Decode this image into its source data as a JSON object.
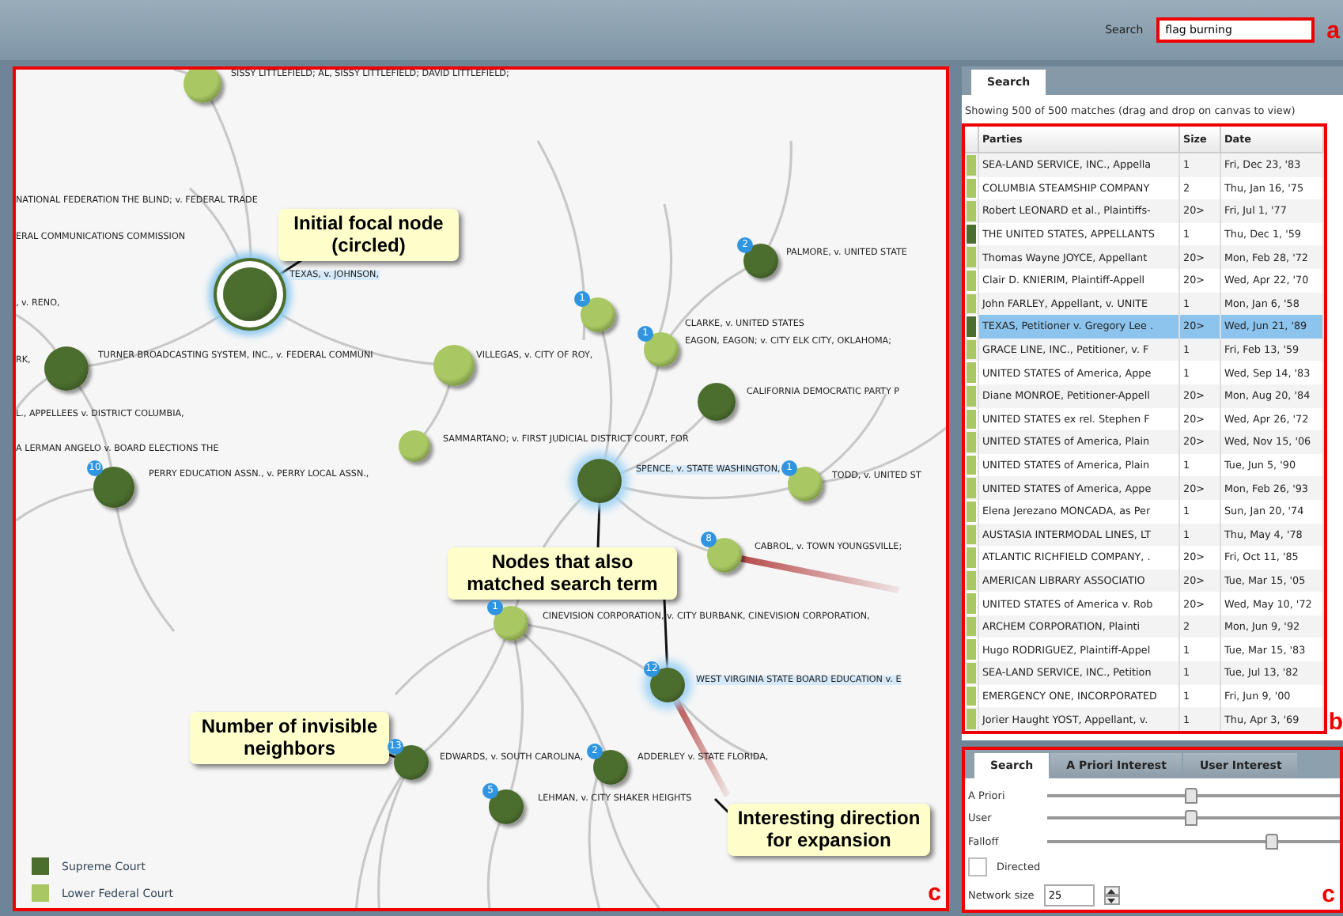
{
  "toolbar": {
    "search_label": "Search",
    "search_value": "flag burning",
    "annotation": "a"
  },
  "canvas": {
    "annotation": "c",
    "fragments": [
      "NATIONAL FEDERATION THE BLIND; v. FEDERAL TRADE",
      "ERAL COMMUNICATIONS COMMISSION",
      ", v. RENO,",
      "RK,",
      "L., APPELLEES v. DISTRICT COLUMBIA,",
      "A LERMAN ANGELO v. BOARD ELECTIONS THE",
      "EAGON, EAGON; v. CITY ELK CITY, OKLAHOMA;"
    ],
    "nodes": [
      {
        "label": "SISSY LITTLEFIELD; AL, SISSY LITTLEFIELD; DAVID LITTLEFIELD;",
        "kind": "lower",
        "matched": false,
        "focal": false,
        "expansion": false
      },
      {
        "label": "TEXAS, v. JOHNSON,",
        "kind": "supreme",
        "matched": true,
        "focal": true,
        "expansion": false
      },
      {
        "label": "TURNER BROADCASTING SYSTEM, INC., v. FEDERAL COMMUNI",
        "kind": "supreme",
        "matched": false,
        "focal": false,
        "expansion": false
      },
      {
        "label": "VILLEGAS, v. CITY OF ROY,",
        "kind": "lower",
        "matched": false,
        "focal": false,
        "expansion": false
      },
      {
        "label": "PERRY EDUCATION ASSN., v. PERRY LOCAL ASSN.,",
        "kind": "supreme",
        "badge": "10",
        "matched": false,
        "focal": false,
        "expansion": false
      },
      {
        "label": "SAMMARTANO; v. FIRST JUDICIAL DISTRICT COURT, FOR",
        "kind": "lower",
        "matched": false,
        "focal": false,
        "expansion": false
      },
      {
        "label": "PALMORE, v. UNITED STATE",
        "kind": "supreme",
        "badge": "2",
        "matched": false,
        "focal": false,
        "expansion": false
      },
      {
        "kind": "lower",
        "badge": "1",
        "matched": false,
        "focal": false,
        "expansion": false
      },
      {
        "label": "CLARKE, v. UNITED STATES",
        "kind": "lower",
        "badge": "1",
        "matched": false,
        "focal": false,
        "expansion": false
      },
      {
        "label": "CALIFORNIA DEMOCRATIC PARTY P",
        "kind": "supreme",
        "matched": false,
        "focal": false,
        "expansion": false
      },
      {
        "label": "SPENCE, v. STATE WASHINGTON,",
        "kind": "supreme",
        "matched": true,
        "focal": false,
        "expansion": false
      },
      {
        "label": "TODD, v. UNITED ST",
        "kind": "lower",
        "badge": "1",
        "matched": false,
        "focal": false,
        "expansion": false
      },
      {
        "label": "CABROL, v. TOWN YOUNGSVILLE;",
        "kind": "lower",
        "badge": "8",
        "matched": false,
        "focal": false,
        "expansion": true
      },
      {
        "label": "CINEVISION CORPORATION, v. CITY BURBANK, CINEVISION CORPORATION,",
        "kind": "lower",
        "badge": "1",
        "matched": false,
        "focal": false,
        "expansion": false
      },
      {
        "label": "WEST VIRGINIA STATE BOARD EDUCATION v. E",
        "kind": "supreme",
        "badge": "12",
        "matched": true,
        "focal": false,
        "expansion": true
      },
      {
        "label": "EDWARDS, v. SOUTH CAROLINA,",
        "kind": "supreme",
        "badge": "13",
        "matched": false,
        "focal": false,
        "expansion": false
      },
      {
        "label": "ADDERLEY v. STATE FLORIDA,",
        "kind": "supreme",
        "badge": "2",
        "matched": false,
        "focal": false,
        "expansion": false
      },
      {
        "label": "LEHMAN, v. CITY SHAKER HEIGHTS",
        "kind": "supreme",
        "badge": "5",
        "matched": false,
        "focal": false,
        "expansion": false
      }
    ],
    "callouts": [
      "Initial focal node (circled)",
      "Nodes that also matched search term",
      "Number of invisible neighbors",
      "Interesting direction for expansion"
    ],
    "legend": [
      {
        "label": "Supreme Court",
        "kind": "supreme"
      },
      {
        "label": "Lower Federal Court",
        "kind": "lower"
      }
    ]
  },
  "results": {
    "tab": {
      "label": "Search",
      "selected": true
    },
    "summary": "Showing 500 of 500 matches (drag and drop on canvas to view)",
    "columns": [
      "Parties",
      "Size",
      "Date"
    ],
    "annotation": "b",
    "rows": [
      {
        "parties": "SEA-LAND SERVICE, INC., Appella",
        "size": "1",
        "date": "Fri, Dec 23, '83",
        "kind": "lower",
        "selected": false
      },
      {
        "parties": "COLUMBIA STEAMSHIP COMPANY",
        "size": "2",
        "date": "Thu, Jan 16, '75",
        "kind": "lower",
        "selected": false
      },
      {
        "parties": "Robert LEONARD et al., Plaintiffs-",
        "size": "20>",
        "date": "Fri, Jul 1, '77",
        "kind": "lower",
        "selected": false
      },
      {
        "parties": "THE UNITED STATES, APPELLANTS",
        "size": "1",
        "date": "Thu, Dec 1, '59",
        "kind": "supreme",
        "selected": false
      },
      {
        "parties": "Thomas Wayne JOYCE, Appellant",
        "size": "20>",
        "date": "Mon, Feb 28, '72",
        "kind": "lower",
        "selected": false
      },
      {
        "parties": "Clair D. KNIERIM, Plaintiff-Appell",
        "size": "20>",
        "date": "Wed, Apr 22, '70",
        "kind": "lower",
        "selected": false
      },
      {
        "parties": "John FARLEY, Appellant, v. UNITE",
        "size": "1",
        "date": "Mon, Jan 6, '58",
        "kind": "lower",
        "selected": false
      },
      {
        "parties": "TEXAS, Petitioner v. Gregory Lee .",
        "size": "20>",
        "date": "Wed, Jun 21, '89",
        "kind": "supreme",
        "selected": true
      },
      {
        "parties": "GRACE LINE, INC., Petitioner, v. F",
        "size": "1",
        "date": "Fri, Feb 13, '59",
        "kind": "lower",
        "selected": false
      },
      {
        "parties": "UNITED STATES of America, Appe",
        "size": "1",
        "date": "Wed, Sep 14, '83",
        "kind": "lower",
        "selected": false
      },
      {
        "parties": "Diane MONROE, Petitioner-Appell",
        "size": "20>",
        "date": "Mon, Aug 20, '84",
        "kind": "lower",
        "selected": false
      },
      {
        "parties": "UNITED STATES ex rel. Stephen F",
        "size": "20>",
        "date": "Wed, Apr 26, '72",
        "kind": "lower",
        "selected": false
      },
      {
        "parties": "UNITED STATES of America, Plain",
        "size": "20>",
        "date": "Wed, Nov 15, '06",
        "kind": "lower",
        "selected": false
      },
      {
        "parties": "UNITED STATES of America, Plain",
        "size": "1",
        "date": "Tue, Jun 5, '90",
        "kind": "lower",
        "selected": false
      },
      {
        "parties": "UNITED STATES of America, Appe",
        "size": "20>",
        "date": "Mon, Feb 26, '93",
        "kind": "lower",
        "selected": false
      },
      {
        "parties": "Elena Jerezano MONCADA, as Per",
        "size": "1",
        "date": "Sun, Jan 20, '74",
        "kind": "lower",
        "selected": false
      },
      {
        "parties": "AUSTASIA INTERMODAL LINES, LT",
        "size": "1",
        "date": "Thu, May 4, '78",
        "kind": "lower",
        "selected": false
      },
      {
        "parties": "ATLANTIC RICHFIELD COMPANY, .",
        "size": "20>",
        "date": "Fri, Oct 11, '85",
        "kind": "lower",
        "selected": false
      },
      {
        "parties": "AMERICAN LIBRARY ASSOCIATIO",
        "size": "20>",
        "date": "Tue, Mar 15, '05",
        "kind": "lower",
        "selected": false
      },
      {
        "parties": "UNITED STATES of America v. Rob",
        "size": "20>",
        "date": "Wed, May 10, '72",
        "kind": "lower",
        "selected": false
      },
      {
        "parties": "ARCHEM CORPORATION, Plainti",
        "size": "2",
        "date": "Mon, Jun 9, '92",
        "kind": "lower",
        "selected": false
      },
      {
        "parties": "Hugo RODRIGUEZ, Plaintiff-Appel",
        "size": "1",
        "date": "Tue, Mar 15, '83",
        "kind": "lower",
        "selected": false
      },
      {
        "parties": "SEA-LAND SERVICE, INC., Petition",
        "size": "1",
        "date": "Tue, Jul 13, '82",
        "kind": "lower",
        "selected": false
      },
      {
        "parties": "EMERGENCY ONE, INCORPORATED",
        "size": "1",
        "date": "Fri, Jun 9, '00",
        "kind": "lower",
        "selected": false
      },
      {
        "parties": "Jorier Haught YOST, Appellant, v.",
        "size": "1",
        "date": "Thu, Apr 3, '69",
        "kind": "lower",
        "selected": false
      }
    ]
  },
  "controls": {
    "annotation": "c",
    "tabs": [
      {
        "label": "Search",
        "selected": true
      },
      {
        "label": "A Priori Interest",
        "selected": false
      },
      {
        "label": "User Interest",
        "selected": false
      }
    ],
    "sliders": [
      {
        "label": "A Priori",
        "level": 0.49
      },
      {
        "label": "User",
        "level": 0.49
      },
      {
        "label": "Falloff",
        "level": 0.77
      }
    ],
    "directed": {
      "label": "Directed",
      "checked": false
    },
    "network_size": {
      "label": "Network size",
      "value": "25"
    }
  }
}
